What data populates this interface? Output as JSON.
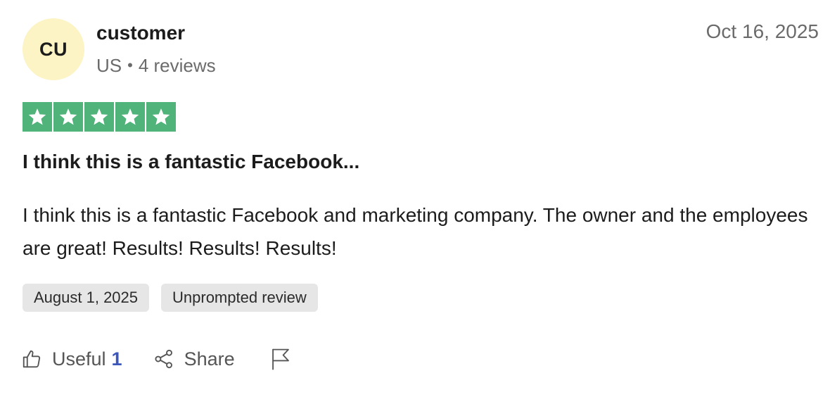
{
  "reviewer": {
    "initials": "CU",
    "name": "customer",
    "country": "US",
    "separator": "•",
    "review_count": "4 reviews"
  },
  "review": {
    "posted_date": "Oct 16, 2025",
    "rating": 5,
    "rating_max": 5,
    "title": "I think this is a fantastic Facebook...",
    "body": "I think this is a fantastic Facebook and marketing company. The owner and the employees are great! Results! Results! Results!",
    "tags": [
      "August 1, 2025",
      "Unprompted review"
    ]
  },
  "actions": {
    "useful_label": "Useful",
    "useful_count": "1",
    "share_label": "Share"
  },
  "icons": {
    "useful": "thumbs-up-icon",
    "share": "share-icon",
    "report": "flag-icon",
    "rating": "star-icon"
  },
  "colors": {
    "star_background": "#4fb37a",
    "avatar_background": "#fcf4c4",
    "useful_count": "#3c57bc",
    "tag_background": "#e6e6e6"
  }
}
